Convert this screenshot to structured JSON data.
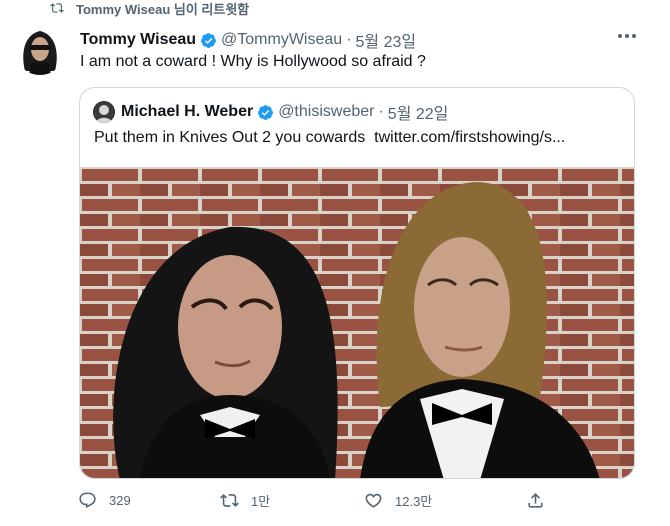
{
  "retweet": {
    "label": "Tommy Wiseau 님이 리트윗함",
    "icon": "retweet-icon"
  },
  "tweet": {
    "author_name": "Tommy Wiseau",
    "handle": "@TommyWiseau",
    "separator": "·",
    "date": "5월 23일",
    "text": "I am not a coward ! Why is Hollywood so afraid ?",
    "more_icon": "more-icon"
  },
  "quote": {
    "author_name": "Michael H. Weber",
    "handle": "@thisisweber",
    "separator": "·",
    "date": "5월 22일",
    "text": "Put them in Knives Out 2 you cowards",
    "link": "twitter.com/firstshowing/s..."
  },
  "actions": {
    "reply_count": "329",
    "retweet_count": "1만",
    "like_count": "12.3만"
  },
  "colors": {
    "text_primary": "#0f1419",
    "text_secondary": "#536471",
    "verified_blue": "#1d9bf0",
    "border": "#cfd9de",
    "brick": "#8a4a3a"
  }
}
